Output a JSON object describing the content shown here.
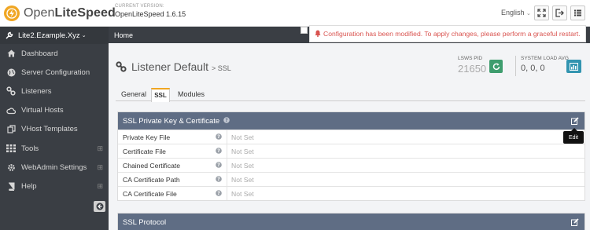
{
  "header": {
    "logo_light": "Open",
    "logo_bold": "LiteSpeed",
    "version_label": "CURRENT VERSION:",
    "version_value": "OpenLiteSpeed 1.6.15",
    "language": "English"
  },
  "sidebar": {
    "server_name": "Lite2.Ezample.Xyz",
    "items": [
      {
        "label": "Dashboard",
        "icon": "home-icon"
      },
      {
        "label": "Server Configuration",
        "icon": "globe-icon"
      },
      {
        "label": "Listeners",
        "icon": "link-icon"
      },
      {
        "label": "Virtual Hosts",
        "icon": "cloud-icon"
      },
      {
        "label": "VHost Templates",
        "icon": "copy-icon"
      },
      {
        "label": "Tools",
        "icon": "grid-icon"
      },
      {
        "label": "WebAdmin Settings",
        "icon": "gear-icon"
      },
      {
        "label": "Help",
        "icon": "book-icon"
      }
    ]
  },
  "breadcrumb": {
    "home": "Home"
  },
  "alert": {
    "text": "Configuration has been modified. To apply changes, please perform a graceful restart."
  },
  "page": {
    "title": "Listener Default",
    "subtitle": "> SSL",
    "pid_label": "LSWS PID",
    "pid_value": "21650",
    "load_label": "SYSTEM LOAD AVG",
    "load_value": "0, 0, 0"
  },
  "tabs": {
    "general": "General",
    "ssl": "SSL",
    "modules": "Modules"
  },
  "panel_keycert": {
    "title": "SSL Private Key & Certificate",
    "rows": [
      {
        "label": "Private Key File",
        "value": "Not Set"
      },
      {
        "label": "Certificate File",
        "value": "Not Set"
      },
      {
        "label": "Chained Certificate",
        "value": "Not Set"
      },
      {
        "label": "CA Certificate Path",
        "value": "Not Set"
      },
      {
        "label": "CA Certificate File",
        "value": "Not Set"
      }
    ]
  },
  "panel_protocol": {
    "title": "SSL Protocol"
  },
  "tooltip": {
    "text": "Edit"
  },
  "colors": {
    "sidebar_bg": "#3a3e44",
    "panel_header": "#5f6d84",
    "accent": "#f0a623",
    "alert": "#d9534f",
    "restart_btn": "#3e9d6e",
    "stats_btn": "#3294b0"
  }
}
